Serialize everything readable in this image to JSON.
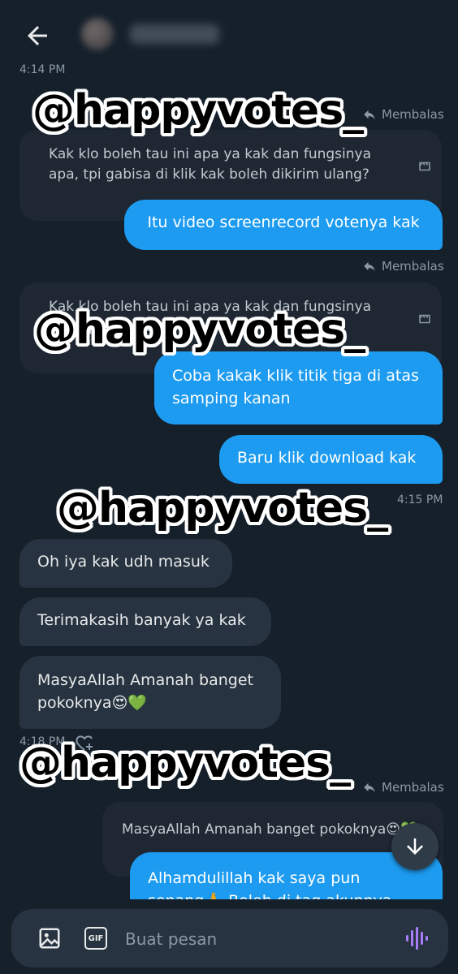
{
  "watermark": "@happyvotes_",
  "composer": {
    "placeholder": "Buat pesan",
    "gif_label": "GIF"
  },
  "messages": {
    "ts_top": "4:14 PM",
    "reply1_label": "Membalas",
    "quote1": "Kak klo boleh tau ini apa ya kak dan fungsinya apa, tpi gabisa di klik kak boleh dikirim ulang?",
    "out1": "Itu video screenrecord votenya kak",
    "reply2_label": "Membalas",
    "quote2_line1": "Kak klo boleh tau ini apa ya kak dan fungsinya",
    "quote2_line2": "apa, tpi gabisa",
    "out2": "Coba kakak klik titik tiga di atas samping kanan",
    "out3": "Baru klik download kak",
    "ts_415": "4:15 PM",
    "in1": "Oh iya kak udh masuk",
    "in2": "Terimakasih banyak ya kak",
    "in3": "MasyaAllah Amanah banget pokoknya😍💚",
    "ts_418": "4:18 PM",
    "reply3_label": "Membalas",
    "quote3": "MasyaAllah Amanah banget pokoknya😍💚",
    "out4_line1": "Alhamdulillah kak saya pun",
    "out4_line2": "senang🙏 Boleh di tag akunnya kak?"
  },
  "colors": {
    "background": "#15202b",
    "bubble_out": "#1d9bf0",
    "bubble_in": "#273340",
    "mic_accent": "#a97cf8"
  }
}
